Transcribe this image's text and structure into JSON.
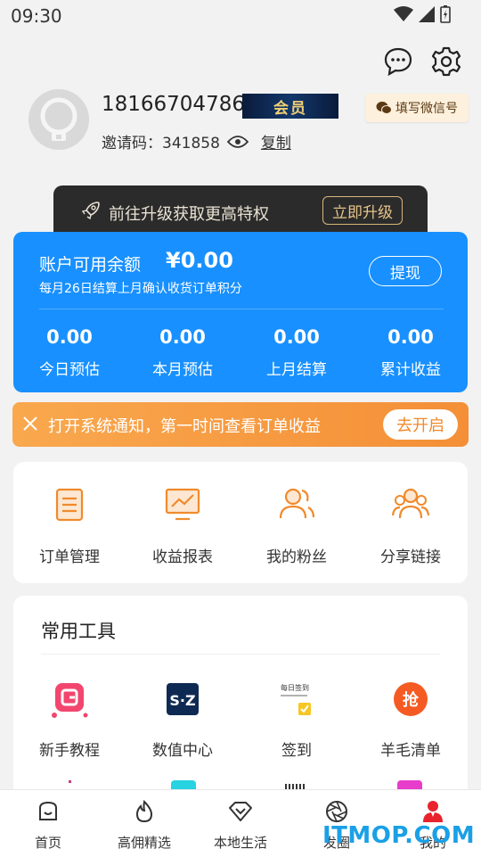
{
  "status_bar": {
    "time": "09:30"
  },
  "header": {
    "message_icon": "chat-bubble-icon",
    "settings_icon": "gear-icon"
  },
  "profile": {
    "phone": "18166704786",
    "vip_label": "会员",
    "wechat_button": "填写微信号",
    "invite_label": "邀请码：",
    "invite_code": "341858",
    "copy_label": "复制"
  },
  "upgrade": {
    "text": "前往升级获取更高特权",
    "button": "立即升级"
  },
  "balance": {
    "title": "账户可用余额",
    "amount": "¥0.00",
    "subtitle": "每月26日结算上月确认收货订单积分",
    "withdraw": "提现",
    "stats": [
      {
        "value": "0.00",
        "label": "今日预估"
      },
      {
        "value": "0.00",
        "label": "本月预估"
      },
      {
        "value": "0.00",
        "label": "上月结算"
      },
      {
        "value": "0.00",
        "label": "累计收益"
      }
    ]
  },
  "notice": {
    "text": "打开系统通知，第一时间查看订单收益",
    "button": "去开启"
  },
  "functions": [
    {
      "label": "订单管理",
      "icon": "order-list-icon"
    },
    {
      "label": "收益报表",
      "icon": "chart-report-icon"
    },
    {
      "label": "我的粉丝",
      "icon": "fans-icon"
    },
    {
      "label": "分享链接",
      "icon": "share-group-icon"
    }
  ],
  "tools": {
    "title": "常用工具",
    "items": [
      {
        "label": "新手教程",
        "icon": "tutorial-icon"
      },
      {
        "label": "数值中心",
        "icon": "sz-data-icon"
      },
      {
        "label": "签到",
        "icon": "checkin-icon"
      },
      {
        "label": "羊毛清单",
        "icon": "grab-deals-icon"
      }
    ],
    "checkin_icon_text": "每日签到"
  },
  "tabbar": [
    {
      "label": "首页",
      "icon": "home-icon"
    },
    {
      "label": "高佣精选",
      "icon": "flame-icon"
    },
    {
      "label": "本地生活",
      "icon": "diamond-icon"
    },
    {
      "label": "发圈",
      "icon": "camera-aperture-icon"
    },
    {
      "label": "我的",
      "icon": "profile-icon"
    }
  ],
  "watermark": "ITMOP.COM",
  "colors": {
    "primary": "#1890ff",
    "notice": "#f48f37",
    "accent_orange": "#f08a2c"
  }
}
